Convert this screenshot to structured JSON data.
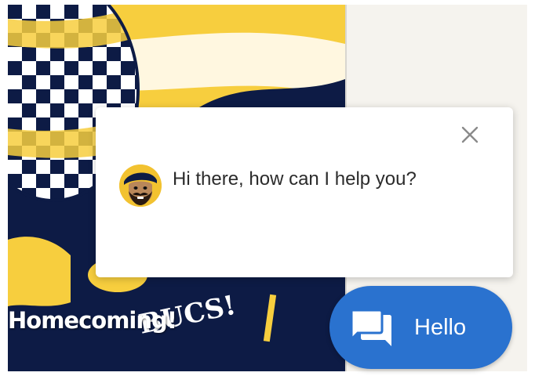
{
  "banner": {
    "caption": "Homecoming!",
    "lettering": "BUCS!",
    "colors": {
      "navy": "#0d1b45",
      "gold": "#f7ce3e",
      "cream": "#fff7e0"
    }
  },
  "chat": {
    "message": "Hi there, how can I help you?",
    "close_icon": "close-icon",
    "avatar_icon": "pirate-mascot-icon"
  },
  "launcher": {
    "label": "Hello",
    "icon": "chat-bubbles-icon",
    "color": "#2a72cf"
  }
}
